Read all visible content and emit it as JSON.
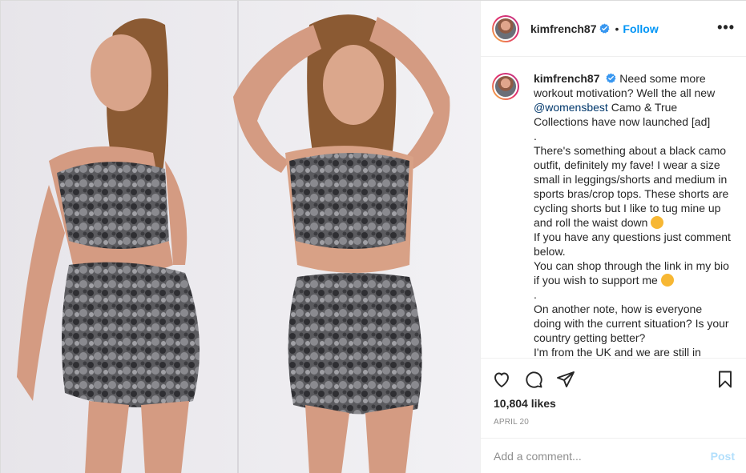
{
  "post": {
    "username": "kimfrench87",
    "follow_label": "Follow",
    "separator": "•",
    "more_label": "•••",
    "caption": {
      "username": "kimfrench87",
      "lines": [
        "Need some more workout motivation? Well the all new",
        "@womensbest",
        "Camo & True Collections have now launched [ad]",
        ".",
        "There's something about a black camo outfit, definitely my fave! I wear a size small in leggings/shorts and medium in sports bras/crop tops. These shorts are cycling shorts but I like to tug mine up and roll the waist down",
        "If you have any questions just comment below.",
        "You can shop through the link in my bio if you wish to support me",
        ".",
        "On another note, how is everyone doing with the current situation? Is your country getting better?",
        "I'm from the UK and we are still in"
      ]
    },
    "likes": "10,804 likes",
    "date": "APRIL 20",
    "comment_placeholder": "Add a comment...",
    "post_label": "Post",
    "colors": {
      "accent": "#0095f6",
      "mention": "#00376b",
      "muted": "#8e8e8e",
      "post_disabled": "#b2dffc"
    },
    "icons": [
      "verified-badge-icon",
      "heart-icon",
      "comment-icon",
      "share-icon",
      "bookmark-icon",
      "more-options-icon"
    ]
  }
}
